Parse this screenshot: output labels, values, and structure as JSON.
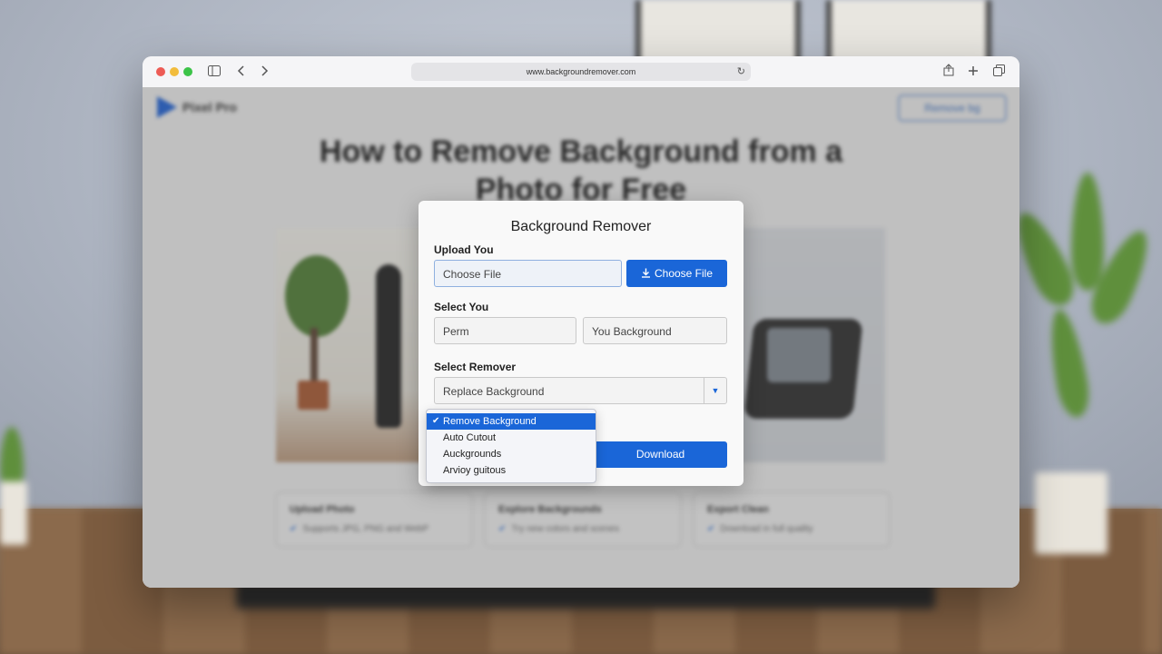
{
  "browser": {
    "url": "www.backgroundremover.com",
    "icons": [
      "sidebar-icon",
      "back-icon",
      "forward-icon",
      "reload-icon",
      "share-icon",
      "new-tab-icon",
      "tabs-overview-icon"
    ]
  },
  "page": {
    "logo_text": "Pixel Pro",
    "nav_button": "Remove bg",
    "hero_title": "How to Remove Background from a Photo for Free",
    "cards": [
      {
        "title": "Upload Photo",
        "line": "Supports JPG, PNG and WebP"
      },
      {
        "title": "Explore Backgrounds",
        "line": "Try new colors and scenes"
      },
      {
        "title": "Export Clean",
        "line": "Download in full quality"
      }
    ]
  },
  "modal": {
    "title": "Background Remover",
    "upload_label": "Upload You",
    "file_field_value": "Choose File",
    "choose_file_button": "Choose File",
    "select_label": "Select You",
    "select_field_1": "Perm",
    "select_field_2": "You Background",
    "remover_label": "Select Remover",
    "remover_value": "Replace Background",
    "download_button": "Download"
  },
  "dropdown": {
    "options": [
      {
        "label": "Remove Background",
        "selected": true
      },
      {
        "label": "Auto Cutout",
        "selected": false
      },
      {
        "label": "Auckgrounds",
        "selected": false
      },
      {
        "label": "Arvioy guitous",
        "selected": false
      }
    ]
  },
  "colors": {
    "accent": "#1a66d8",
    "traffic_red": "#ed5b55",
    "traffic_yellow": "#f2bc3c",
    "traffic_green": "#3cc348"
  }
}
